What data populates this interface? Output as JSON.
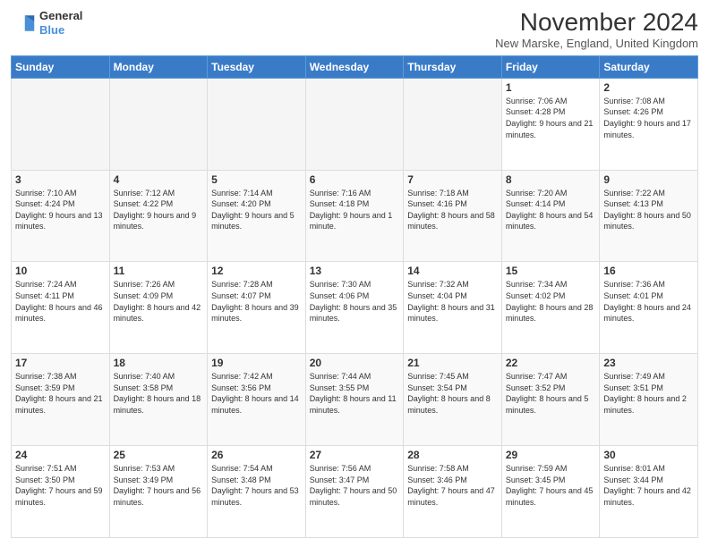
{
  "logo": {
    "line1": "General",
    "line2": "Blue"
  },
  "header": {
    "month": "November 2024",
    "location": "New Marske, England, United Kingdom"
  },
  "days": [
    "Sunday",
    "Monday",
    "Tuesday",
    "Wednesday",
    "Thursday",
    "Friday",
    "Saturday"
  ],
  "weeks": [
    [
      {
        "day": "",
        "empty": true
      },
      {
        "day": "",
        "empty": true
      },
      {
        "day": "",
        "empty": true
      },
      {
        "day": "",
        "empty": true
      },
      {
        "day": "",
        "empty": true
      },
      {
        "day": "1",
        "sunrise": "7:06 AM",
        "sunset": "4:28 PM",
        "daylight": "9 hours and 21 minutes."
      },
      {
        "day": "2",
        "sunrise": "7:08 AM",
        "sunset": "4:26 PM",
        "daylight": "9 hours and 17 minutes."
      }
    ],
    [
      {
        "day": "3",
        "sunrise": "7:10 AM",
        "sunset": "4:24 PM",
        "daylight": "9 hours and 13 minutes."
      },
      {
        "day": "4",
        "sunrise": "7:12 AM",
        "sunset": "4:22 PM",
        "daylight": "9 hours and 9 minutes."
      },
      {
        "day": "5",
        "sunrise": "7:14 AM",
        "sunset": "4:20 PM",
        "daylight": "9 hours and 5 minutes."
      },
      {
        "day": "6",
        "sunrise": "7:16 AM",
        "sunset": "4:18 PM",
        "daylight": "9 hours and 1 minute."
      },
      {
        "day": "7",
        "sunrise": "7:18 AM",
        "sunset": "4:16 PM",
        "daylight": "8 hours and 58 minutes."
      },
      {
        "day": "8",
        "sunrise": "7:20 AM",
        "sunset": "4:14 PM",
        "daylight": "8 hours and 54 minutes."
      },
      {
        "day": "9",
        "sunrise": "7:22 AM",
        "sunset": "4:13 PM",
        "daylight": "8 hours and 50 minutes."
      }
    ],
    [
      {
        "day": "10",
        "sunrise": "7:24 AM",
        "sunset": "4:11 PM",
        "daylight": "8 hours and 46 minutes."
      },
      {
        "day": "11",
        "sunrise": "7:26 AM",
        "sunset": "4:09 PM",
        "daylight": "8 hours and 42 minutes."
      },
      {
        "day": "12",
        "sunrise": "7:28 AM",
        "sunset": "4:07 PM",
        "daylight": "8 hours and 39 minutes."
      },
      {
        "day": "13",
        "sunrise": "7:30 AM",
        "sunset": "4:06 PM",
        "daylight": "8 hours and 35 minutes."
      },
      {
        "day": "14",
        "sunrise": "7:32 AM",
        "sunset": "4:04 PM",
        "daylight": "8 hours and 31 minutes."
      },
      {
        "day": "15",
        "sunrise": "7:34 AM",
        "sunset": "4:02 PM",
        "daylight": "8 hours and 28 minutes."
      },
      {
        "day": "16",
        "sunrise": "7:36 AM",
        "sunset": "4:01 PM",
        "daylight": "8 hours and 24 minutes."
      }
    ],
    [
      {
        "day": "17",
        "sunrise": "7:38 AM",
        "sunset": "3:59 PM",
        "daylight": "8 hours and 21 minutes."
      },
      {
        "day": "18",
        "sunrise": "7:40 AM",
        "sunset": "3:58 PM",
        "daylight": "8 hours and 18 minutes."
      },
      {
        "day": "19",
        "sunrise": "7:42 AM",
        "sunset": "3:56 PM",
        "daylight": "8 hours and 14 minutes."
      },
      {
        "day": "20",
        "sunrise": "7:44 AM",
        "sunset": "3:55 PM",
        "daylight": "8 hours and 11 minutes."
      },
      {
        "day": "21",
        "sunrise": "7:45 AM",
        "sunset": "3:54 PM",
        "daylight": "8 hours and 8 minutes."
      },
      {
        "day": "22",
        "sunrise": "7:47 AM",
        "sunset": "3:52 PM",
        "daylight": "8 hours and 5 minutes."
      },
      {
        "day": "23",
        "sunrise": "7:49 AM",
        "sunset": "3:51 PM",
        "daylight": "8 hours and 2 minutes."
      }
    ],
    [
      {
        "day": "24",
        "sunrise": "7:51 AM",
        "sunset": "3:50 PM",
        "daylight": "7 hours and 59 minutes."
      },
      {
        "day": "25",
        "sunrise": "7:53 AM",
        "sunset": "3:49 PM",
        "daylight": "7 hours and 56 minutes."
      },
      {
        "day": "26",
        "sunrise": "7:54 AM",
        "sunset": "3:48 PM",
        "daylight": "7 hours and 53 minutes."
      },
      {
        "day": "27",
        "sunrise": "7:56 AM",
        "sunset": "3:47 PM",
        "daylight": "7 hours and 50 minutes."
      },
      {
        "day": "28",
        "sunrise": "7:58 AM",
        "sunset": "3:46 PM",
        "daylight": "7 hours and 47 minutes."
      },
      {
        "day": "29",
        "sunrise": "7:59 AM",
        "sunset": "3:45 PM",
        "daylight": "7 hours and 45 minutes."
      },
      {
        "day": "30",
        "sunrise": "8:01 AM",
        "sunset": "3:44 PM",
        "daylight": "7 hours and 42 minutes."
      }
    ]
  ]
}
